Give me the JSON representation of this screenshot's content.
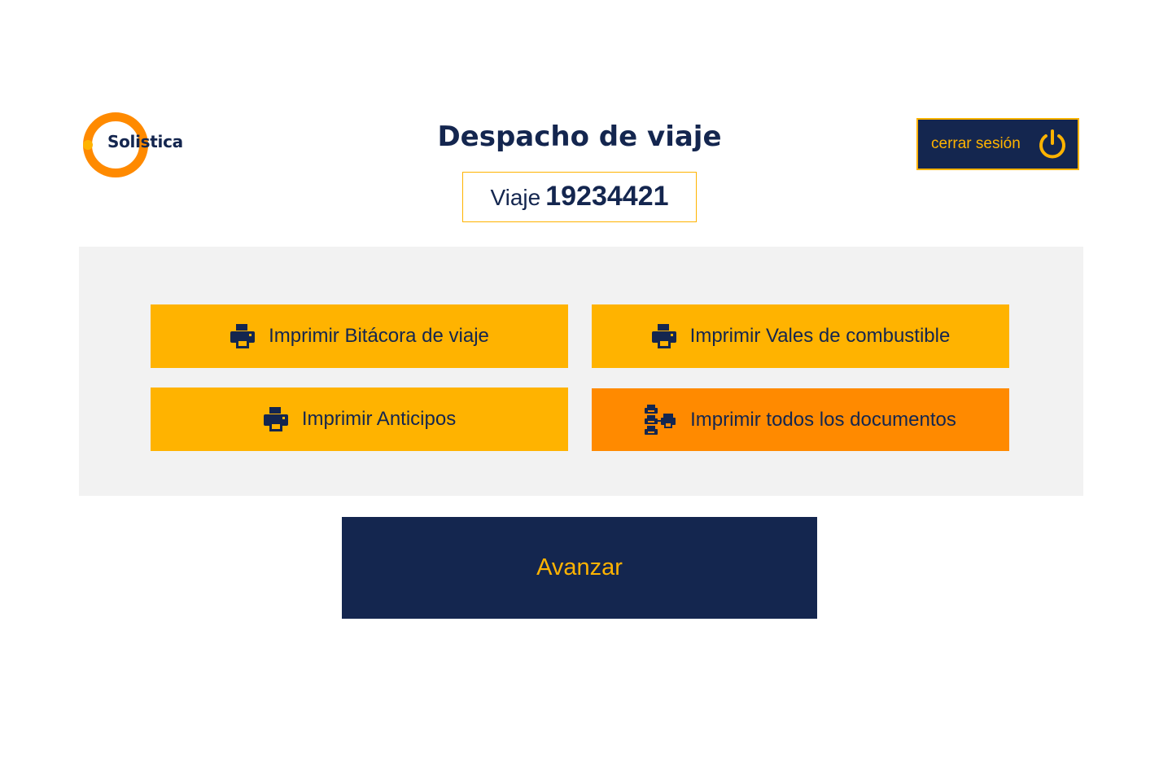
{
  "brand": {
    "logo_text": "Solistica"
  },
  "header": {
    "title": "Despacho de viaje",
    "logout_label": "cerrar sesión"
  },
  "trip": {
    "label": "Viaje",
    "number": "19234421"
  },
  "actions": {
    "print_bitacora": "Imprimir Bitácora de viaje",
    "print_vales": "Imprimir Vales de combustible",
    "print_anticipos": "Imprimir Anticipos",
    "print_todos": "Imprimir todos los documentos"
  },
  "footer": {
    "advance_label": "Avanzar"
  },
  "icons": {
    "logout": "power-icon",
    "print": "printer-icon",
    "print_all": "multiple-printers-icon"
  },
  "colors": {
    "navy": "#14264f",
    "amber": "#ffb300",
    "orange": "#ff8a00",
    "panel": "#f2f2f2"
  }
}
